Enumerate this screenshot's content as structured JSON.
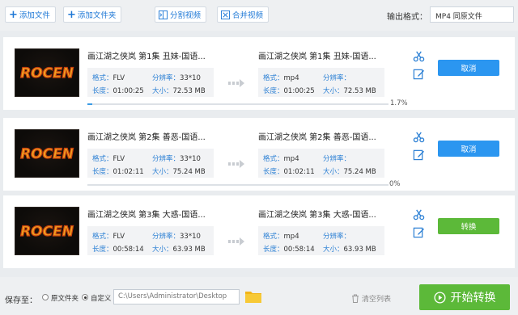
{
  "toolbar": {
    "add_file": "添加文件",
    "add_folder": "添加文件夹",
    "split_video": "分割视频",
    "merge_video": "合并视频",
    "output_format_label": "输出格式：",
    "output_format_value": "MP4  同原文件"
  },
  "tasks": [
    {
      "thumb_text": "ROCEN",
      "src_title": "画江湖之侠岚 第1集 丑妹-国语...",
      "src_format_key": "格式：",
      "src_format": "FLV",
      "src_res_key": "分辨率：",
      "src_res": "33*10",
      "src_len_key": "长度：",
      "src_len": "01:00:25",
      "src_size_key": "大小：",
      "src_size": "72.53 MB",
      "dst_title": "画江湖之侠岚 第1集 丑妹-国语...",
      "dst_format_key": "格式：",
      "dst_format": "mp4",
      "dst_res_key": "分辨率：",
      "dst_res": "",
      "dst_len_key": "长度：",
      "dst_len": "01:00:25",
      "dst_size_key": "大小：",
      "dst_size": "72.53 MB",
      "progress_pct": 1.7,
      "progress_text": "1.7%",
      "action": "取消",
      "action_color": "#2b96f0"
    },
    {
      "thumb_text": "ROCEN",
      "src_title": "画江湖之侠岚 第2集 善恶-国语...",
      "src_format_key": "格式：",
      "src_format": "FLV",
      "src_res_key": "分辨率：",
      "src_res": "33*10",
      "src_len_key": "长度：",
      "src_len": "01:02:11",
      "src_size_key": "大小：",
      "src_size": "75.24 MB",
      "dst_title": "画江湖之侠岚 第2集 善恶-国语...",
      "dst_format_key": "格式：",
      "dst_format": "mp4",
      "dst_res_key": "分辨率：",
      "dst_res": "",
      "dst_len_key": "长度：",
      "dst_len": "01:02:11",
      "dst_size_key": "大小：",
      "dst_size": "75.24 MB",
      "progress_pct": 0,
      "progress_text": "0%",
      "action": "取消",
      "action_color": "#2b96f0"
    },
    {
      "thumb_text": "ROCEN",
      "src_title": "画江湖之侠岚 第3集 大惑-国语...",
      "src_format_key": "格式：",
      "src_format": "FLV",
      "src_res_key": "分辨率：",
      "src_res": "33*10",
      "src_len_key": "长度：",
      "src_len": "00:58:14",
      "src_size_key": "大小：",
      "src_size": "63.93 MB",
      "dst_title": "画江湖之侠岚 第3集 大惑-国语...",
      "dst_format_key": "格式：",
      "dst_format": "mp4",
      "dst_res_key": "分辨率：",
      "dst_res": "",
      "dst_len_key": "长度：",
      "dst_len": "00:58:14",
      "dst_size_key": "大小：",
      "dst_size": "63.93 MB",
      "progress_pct": null,
      "progress_text": "",
      "action": "转换",
      "action_color": "#5cb939"
    }
  ],
  "bottom": {
    "save_to": "保存至：",
    "option_source": "原文件夹",
    "option_custom": "自定义",
    "path": "C:\\Users\\Administrator\\Desktop",
    "clear_list": "清空列表",
    "start": "开始转换"
  },
  "colors": {
    "accent_blue": "#2b96f0",
    "accent_green": "#5cb939",
    "label_blue": "#2a7fd4"
  },
  "icons": [
    "plus-icon",
    "split-icon",
    "merge-icon",
    "scissors-icon",
    "edit-icon",
    "arrow-right-icon",
    "folder-icon",
    "trash-icon",
    "play-circle-icon"
  ]
}
